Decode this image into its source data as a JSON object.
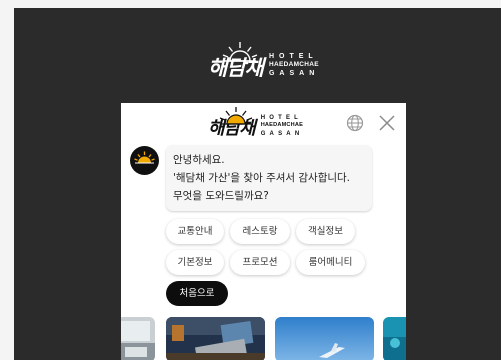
{
  "brand": {
    "korean": "해담채",
    "line1": "HOTEL",
    "line2": "HAEDAMCHAE",
    "line3": "GASAN"
  },
  "chat": {
    "header_icons": [
      "globe-icon",
      "close-icon"
    ],
    "greeting_lines": [
      "안녕하세요.",
      "'해담채 가산'을 찾아 주셔서 감사합니다.",
      "무엇을 도와드릴까요?"
    ],
    "quick_replies": [
      "교통안내",
      "레스토랑",
      "객실정보",
      "기본정보",
      "프로모션",
      "룸어메니티"
    ],
    "reset_label": "처음으로"
  },
  "colors": {
    "page_background": "#2b2b2b",
    "panel_background": "#ffffff",
    "dark_chip": "#0d0d0d",
    "sun_accent": "#f2a900"
  }
}
